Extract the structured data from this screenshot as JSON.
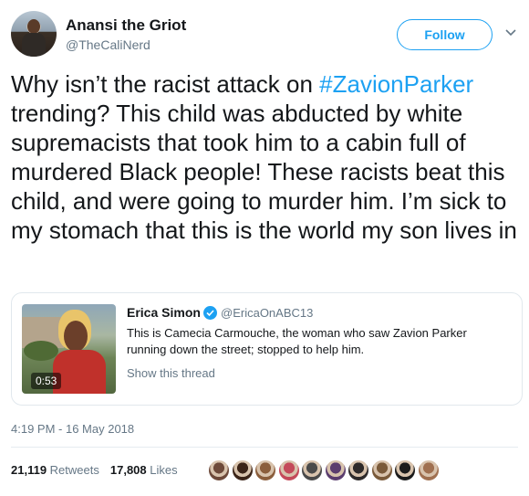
{
  "author": {
    "name": "Anansi the Griot",
    "handle": "@TheCaliNerd",
    "follow_label": "Follow"
  },
  "tweet": {
    "text_before": "Why isn’t the racist attack on ",
    "hashtag": "#ZavionParker",
    "text_after": " trending? This child was abducted by white supremacists that took him to a cabin full of murdered Black people! These racists beat this child, and were going to murder him. I’m sick to my stomach that this is the world my son lives in"
  },
  "quote": {
    "name": "Erica Simon",
    "handle": "@EricaOnABC13",
    "text": "This is Camecia Carmouche, the woman who saw Zavion Parker running down the street; stopped to help him.",
    "show_thread": "Show this thread",
    "video_duration": "0:53"
  },
  "timestamp": "4:19 PM - 16 May 2018",
  "stats": {
    "retweets_count": "21,119",
    "retweets_label": "Retweets",
    "likes_count": "17,808",
    "likes_label": "Likes"
  },
  "likers": [
    {
      "icon": "avatar",
      "color": "#6e4a3a"
    },
    {
      "icon": "avatar",
      "color": "#3b2418"
    },
    {
      "icon": "avatar",
      "color": "#8b5e3c"
    },
    {
      "icon": "avatar",
      "color": "#c44a5a"
    },
    {
      "icon": "avatar",
      "color": "#4a4a4a"
    },
    {
      "icon": "avatar",
      "color": "#5b3d6e"
    },
    {
      "icon": "avatar",
      "color": "#2e2a2a"
    },
    {
      "icon": "avatar",
      "color": "#7a5a3a"
    },
    {
      "icon": "avatar",
      "color": "#1c1c1c"
    },
    {
      "icon": "avatar",
      "color": "#a07050"
    }
  ],
  "colors": {
    "accent": "#1da1f2",
    "secondary_text": "#657786",
    "primary_text": "#14171a"
  }
}
